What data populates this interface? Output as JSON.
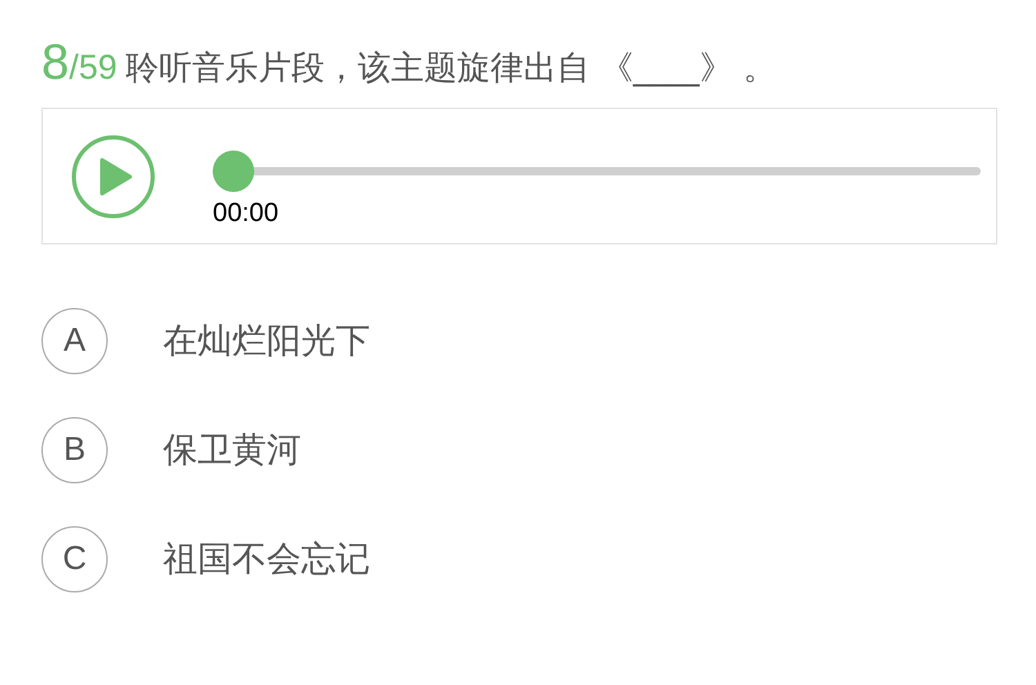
{
  "question": {
    "number": "8",
    "total": "/59",
    "text": "聆听音乐片段，该主题旋律出自 《____》 。"
  },
  "player": {
    "level": 0,
    "time": "00:00"
  },
  "options": [
    {
      "letter": "A",
      "text": "在灿烂阳光下"
    },
    {
      "letter": "B",
      "text": "保卫黄河"
    },
    {
      "letter": "C",
      "text": "祖国不会忘记"
    }
  ]
}
